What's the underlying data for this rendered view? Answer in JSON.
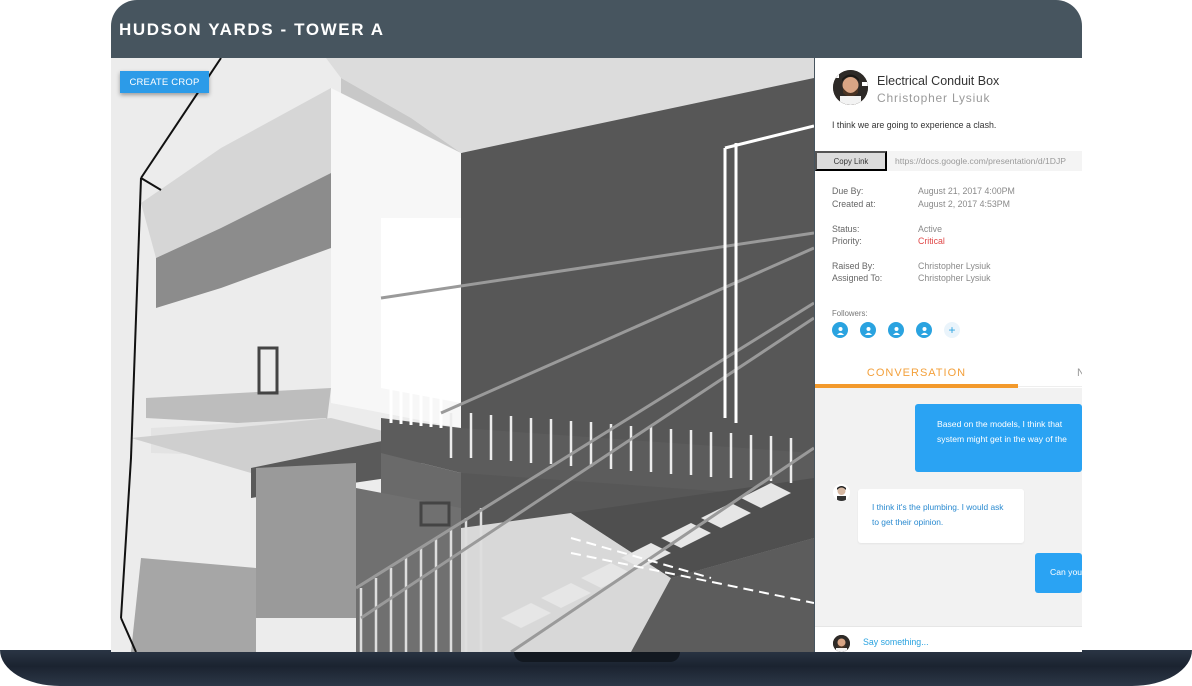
{
  "app": {
    "title": "HUDSON YARDS - TOWER A"
  },
  "viewport": {
    "create_crop_label": "CREATE CROP"
  },
  "issue": {
    "title": "Electrical Conduit Box",
    "author": "Christopher Lysiuk",
    "description": "I think we are going to experience a clash.",
    "copy_link_label": "Copy Link",
    "link_url": "https://docs.google.com/presentation/d/1DJP",
    "fields": {
      "due_by_label": "Due By:",
      "due_by": "August 21, 2017 4:00PM",
      "created_at_label": "Created at:",
      "created_at": "August 2, 2017 4:53PM",
      "status_label": "Status:",
      "status": "Active",
      "priority_label": "Priority:",
      "priority": "Critical",
      "raised_by_label": "Raised By:",
      "raised_by": "Christopher Lysiuk",
      "assigned_to_label": "Assigned To:",
      "assigned_to": "Christopher Lysiuk"
    },
    "followers_label": "Followers:",
    "followers_count": 4,
    "add_follower_icon": "plus-icon",
    "priority_color": "#e04848"
  },
  "tabs": {
    "conversation": "CONVERSATION",
    "next_partial": "N"
  },
  "conversation": {
    "messages": [
      {
        "direction": "out",
        "lines": [
          "Based on the models, I think that",
          "system might get in the way of the"
        ]
      },
      {
        "direction": "in",
        "lines": [
          "I think it's the plumbing. I would ask",
          "to get their opinion."
        ]
      },
      {
        "direction": "out",
        "lines": [
          "Can you"
        ]
      }
    ],
    "composer_placeholder": "Say something..."
  },
  "colors": {
    "header": "#47555f",
    "accent_blue": "#2aa3f3",
    "tab_orange": "#f39a2c",
    "create_crop": "#2c9be8"
  }
}
